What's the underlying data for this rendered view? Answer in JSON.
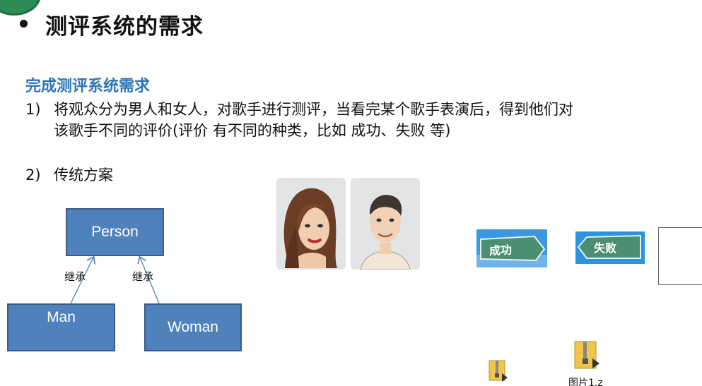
{
  "slide": {
    "title": "测评系统的需求",
    "section_heading": "完成测评系统需求",
    "item1": {
      "number": "1)",
      "line1": "将观众分为男人和女人，对歌手进行测评，当看完某个歌手表演后，得到他们对",
      "line2": "该歌手不同的评价(评价 有不同的种类，比如 成功、失败 等)"
    },
    "item2": {
      "number": "2)",
      "text": "传统方案"
    }
  },
  "diagram": {
    "parent": "Person",
    "children": [
      "Man",
      "Woman"
    ],
    "edge_labels": [
      "继承",
      "继承"
    ]
  },
  "images": {
    "signs": [
      "成功",
      "失败"
    ]
  },
  "desktop_files": [
    {
      "label": "",
      "icon": "zip-folder-icon"
    },
    {
      "label": "图片1.z",
      "icon": "zip-folder-icon"
    }
  ],
  "colors": {
    "title_text": "#111111",
    "heading_blue": "#2e75b6",
    "box_fill": "#4f81bd",
    "box_border": "#385d8a",
    "sign_green": "#4a8f72",
    "sign_sky": "#1e88d8"
  }
}
